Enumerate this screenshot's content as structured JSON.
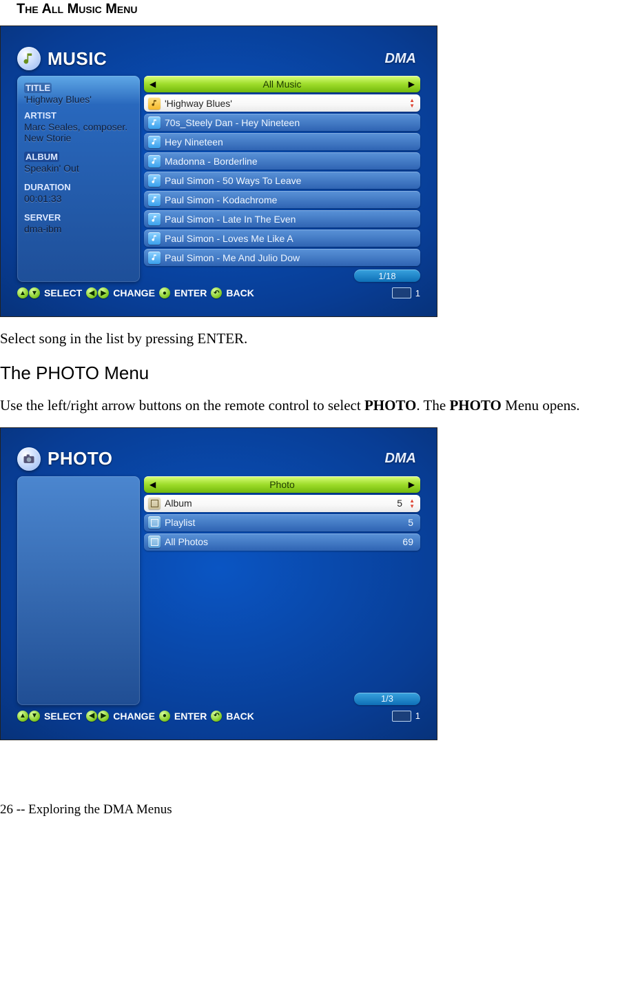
{
  "doc": {
    "section_heading": "The All Music Menu",
    "after_music_text_pre": "Select song in the list by pressing ENTER.",
    "heading_photo": "The PHOTO Menu",
    "photo_text_a": "Use the left/right arrow buttons on the remote control to select ",
    "photo_text_b": ". The ",
    "photo_text_c": " Menu opens.",
    "photo_bold": "PHOTO",
    "footer": "26  --  Exploring the DMA Menus"
  },
  "music_ui": {
    "logo": "DMA",
    "title": "MUSIC",
    "tab_label": "All Music",
    "sidebar": {
      "title_label": "TITLE",
      "title_value": "'Highway Blues'",
      "artist_label": "ARTIST",
      "artist_value": "Marc Seales, composer. New Storie",
      "album_label": "ALBUM",
      "album_value": "Speakin' Out",
      "duration_label": "DURATION",
      "duration_value": "00:01:33",
      "server_label": "SERVER",
      "server_value": "dma-ibm"
    },
    "rows": [
      {
        "label": "'Highway Blues'",
        "selected": true
      },
      {
        "label": "70s_Steely Dan - Hey Nineteen"
      },
      {
        "label": "Hey Nineteen"
      },
      {
        "label": "Madonna - Borderline"
      },
      {
        "label": "Paul Simon - 50 Ways To Leave"
      },
      {
        "label": "Paul Simon - Kodachrome"
      },
      {
        "label": "Paul Simon - Late In The Even"
      },
      {
        "label": "Paul Simon - Loves Me Like A"
      },
      {
        "label": "Paul Simon - Me And Julio Dow"
      }
    ],
    "page_indicator": "1/18",
    "hints": {
      "select": "SELECT",
      "change": "CHANGE",
      "enter": "ENTER",
      "back": "BACK",
      "hdd_num": "1"
    }
  },
  "photo_ui": {
    "logo": "DMA",
    "title": "PHOTO",
    "tab_label": "Photo",
    "rows": [
      {
        "label": "Album",
        "count": "5",
        "selected": true
      },
      {
        "label": "Playlist",
        "count": "5"
      },
      {
        "label": "All Photos",
        "count": "69"
      }
    ],
    "page_indicator": "1/3",
    "hints": {
      "select": "SELECT",
      "change": "CHANGE",
      "enter": "ENTER",
      "back": "BACK",
      "hdd_num": "1"
    }
  }
}
